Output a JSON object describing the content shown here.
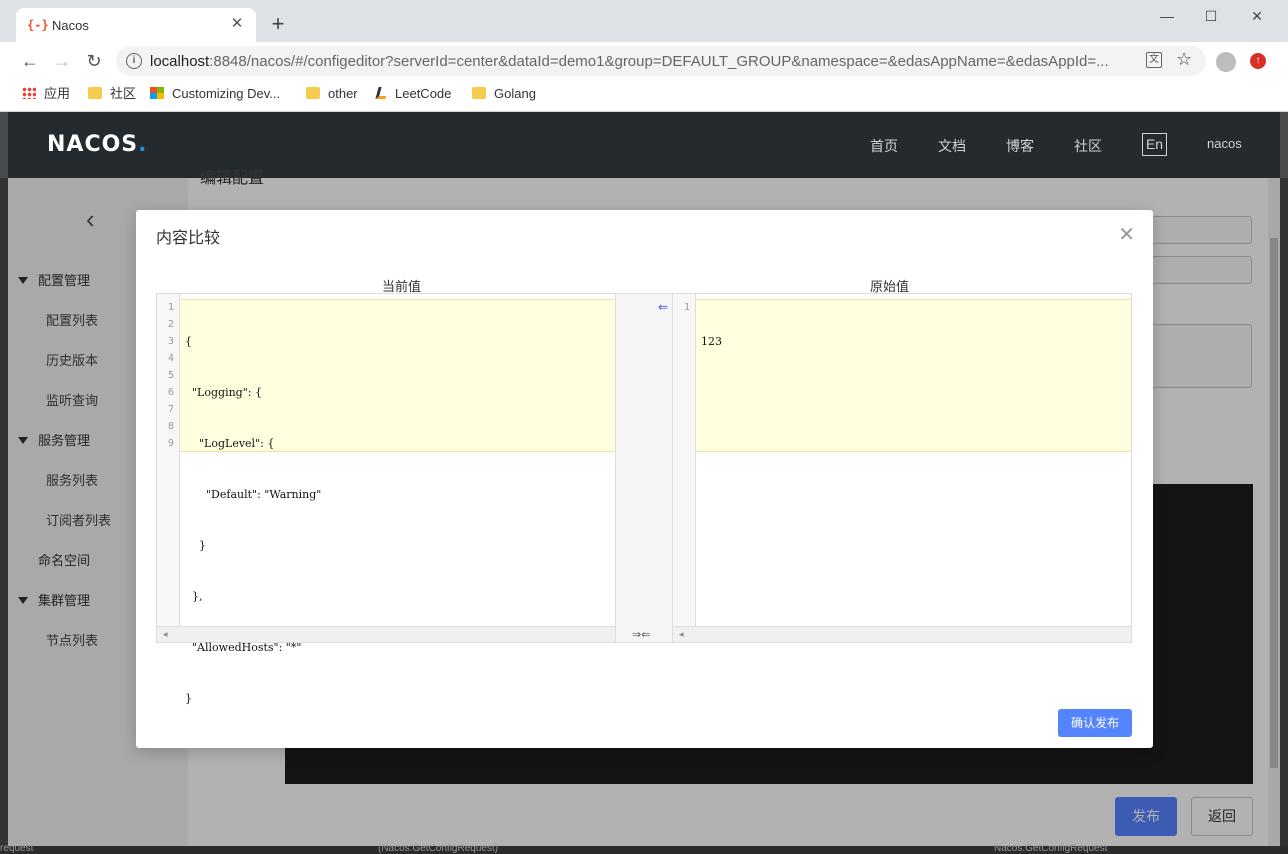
{
  "browser": {
    "tab_title": "Nacos",
    "tab_favicon": "{-}",
    "url_host": "localhost",
    "url_rest": ":8848/nacos/#/configeditor?serverId=center&dataId=demo1&group=DEFAULT_GROUP&namespace=&edasAppName=&edasAppId=...",
    "bookmarks": [
      "应用",
      "社区",
      "Customizing Dev...",
      "other",
      "LeetCode",
      "Golang"
    ]
  },
  "topnav": {
    "logo_main": "NACOS",
    "logo_dot": ".",
    "links": [
      "首页",
      "文档",
      "博客",
      "社区"
    ],
    "lang": "En",
    "user": "nacos"
  },
  "sidebar": {
    "groups": [
      {
        "label": "配置管理",
        "items": [
          "配置列表",
          "历史版本",
          "监听查询"
        ]
      },
      {
        "label": "服务管理",
        "items": [
          "服务列表",
          "订阅者列表"
        ]
      },
      {
        "label": "命名空间",
        "items": []
      },
      {
        "label": "集群管理",
        "items": [
          "节点列表"
        ]
      }
    ]
  },
  "main": {
    "title": "编辑配置",
    "publish_label": "发布",
    "back_label": "返回"
  },
  "dialog": {
    "title": "内容比较",
    "current_label": "当前值",
    "original_label": "原始值",
    "current_lines": [
      "{",
      "  \"Logging\": {",
      "    \"LogLevel\": {",
      "      \"Default\": \"Warning\"",
      "    }",
      "  },",
      "  \"AllowedHosts\": \"*\"",
      "}",
      ""
    ],
    "original_lines": [
      "123"
    ],
    "confirm_label": "确认发布"
  },
  "bottom": {
    "left": "request",
    "mid": "(Nacos.GetConfigRequest)",
    "right": "Nacos.GetConfigRequest"
  }
}
